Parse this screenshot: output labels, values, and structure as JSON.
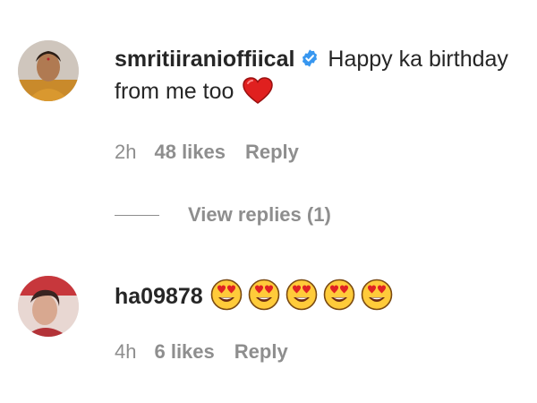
{
  "comments": [
    {
      "username": "smritiiranioffiical",
      "verified": true,
      "text": "Happy ka birthday from me too",
      "emoji": "red-heart",
      "time": "2h",
      "likes": "48 likes",
      "reply": "Reply",
      "view_replies": "View replies (1)"
    },
    {
      "username": "ha09878",
      "text": "",
      "emoji": "heart-eyes-face x5",
      "time": "4h",
      "likes": "6 likes",
      "reply": "Reply"
    }
  ],
  "colors": {
    "text": "#262626",
    "muted": "#8e8e8e",
    "verified": "#3897f0",
    "heart": "#ed4956"
  }
}
